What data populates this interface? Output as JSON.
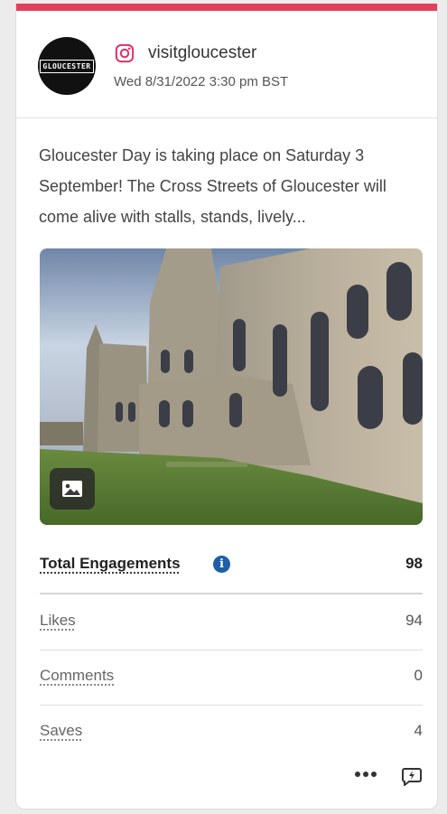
{
  "post": {
    "avatar_text": "GLOUCESTER",
    "network_icon": "instagram-icon",
    "account": "visitgloucester",
    "date": "Wed 8/31/2022 3:30 pm BST",
    "caption": "Gloucester Day is taking place on Saturday 3 September! The Cross Streets of Gloucester will come alive with stalls, stands, lively..."
  },
  "media": {
    "type_icon": "image-icon"
  },
  "metrics": {
    "total": {
      "label": "Total Engagements",
      "value": "98"
    },
    "items": [
      {
        "label": "Likes",
        "value": "94"
      },
      {
        "label": "Comments",
        "value": "0"
      },
      {
        "label": "Saves",
        "value": "4"
      }
    ]
  },
  "actions": {
    "more_icon": "more-options-icon",
    "comment_icon": "comment-reply-icon"
  },
  "colors": {
    "accent": "#e0405e",
    "info": "#1d5fa8",
    "instagram": "#e1306c"
  }
}
